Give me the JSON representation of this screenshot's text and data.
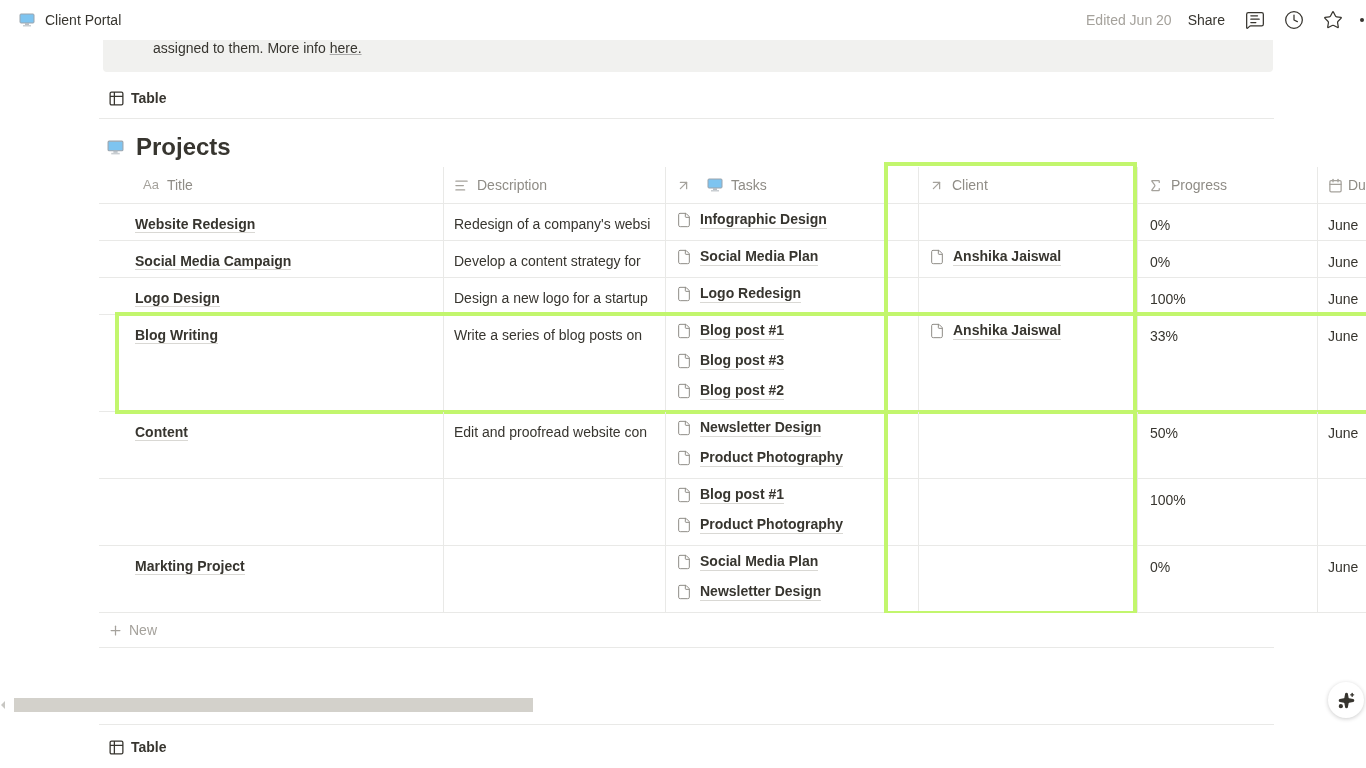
{
  "top_bar": {
    "title": "Client Portal",
    "edited": "Edited Jun 20",
    "share": "Share"
  },
  "callout": {
    "text": "assigned to them. More info ",
    "link": "here."
  },
  "view_tab": {
    "label": "Table"
  },
  "database": {
    "title": "Projects",
    "columns": [
      {
        "label": "Title",
        "kind": "title",
        "icon_text": "Aa",
        "highlighted": false
      },
      {
        "label": "Description",
        "kind": "text",
        "highlighted": false
      },
      {
        "label": "Tasks",
        "kind": "relation_page",
        "highlighted": false
      },
      {
        "label": "Client",
        "kind": "relation",
        "highlighted": true
      },
      {
        "label": "Progress",
        "kind": "rollup",
        "highlighted": false
      },
      {
        "label": "Du",
        "kind": "date",
        "highlighted": false
      }
    ],
    "rows": [
      {
        "title": "Website Redesign",
        "description": "Redesign of a company's websi",
        "tasks": [
          "Infographic Design"
        ],
        "client": [],
        "progress": "0%",
        "due": "June",
        "highlighted": false
      },
      {
        "title": "Social Media Campaign",
        "description": "Develop a content strategy for",
        "tasks": [
          "Social Media Plan"
        ],
        "client": [
          "Anshika Jaiswal"
        ],
        "progress": "0%",
        "due": "June",
        "highlighted": false
      },
      {
        "title": "Logo Design",
        "description": "Design a new logo for a startup",
        "tasks": [
          "Logo Redesign"
        ],
        "client": [],
        "progress": "100%",
        "due": "June",
        "highlighted": false
      },
      {
        "title": "Blog Writing",
        "description": "Write a series of blog posts on",
        "tasks": [
          "Blog post #1",
          "Blog post #3",
          "Blog post #2"
        ],
        "client": [
          "Anshika Jaiswal"
        ],
        "progress": "33%",
        "due": "June",
        "highlighted": true
      },
      {
        "title": "Content",
        "description": "Edit and proofread website con",
        "tasks": [
          "Newsletter Design",
          "Product Photography"
        ],
        "client": [],
        "progress": "50%",
        "due": "June",
        "highlighted": false
      },
      {
        "title": "",
        "description": "",
        "tasks": [
          "Blog post #1",
          "Product Photography"
        ],
        "client": [],
        "progress": "100%",
        "due": "",
        "highlighted": false
      },
      {
        "title": "Markting Project",
        "description": "",
        "tasks": [
          "Social Media Plan",
          "Newsletter Design"
        ],
        "client": [],
        "progress": "0%",
        "due": "June",
        "highlighted": false
      }
    ],
    "new_label": "New"
  },
  "bottom_view_tab": {
    "label": "Table"
  }
}
